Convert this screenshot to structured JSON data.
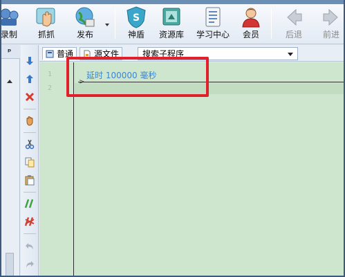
{
  "toolbar": {
    "items": [
      {
        "label": "录制",
        "icon": "record-icon"
      },
      {
        "label": "抓抓",
        "icon": "grab-hand-icon"
      },
      {
        "label": "发布",
        "icon": "publish-globe-icon"
      },
      {
        "label": "神盾",
        "icon": "shield-icon"
      },
      {
        "label": "资源库",
        "icon": "resource-library-icon"
      },
      {
        "label": "学习中心",
        "icon": "learning-center-icon"
      },
      {
        "label": "会员",
        "icon": "member-icon"
      },
      {
        "label": "后退",
        "icon": "back-arrow-icon"
      },
      {
        "label": "前进",
        "icon": "forward-arrow-icon"
      }
    ]
  },
  "leftpanel": {
    "pin": "ᵖ"
  },
  "tabs": {
    "normal": "普通",
    "source": "源文件",
    "subroutine_select": "搜索子程序"
  },
  "editor": {
    "line_numbers": [
      "1",
      "2"
    ],
    "lines": [
      "延时 100000 毫秒",
      ""
    ]
  },
  "colors": {
    "editor_bg": "#cde6cd",
    "code_text": "#3a86d6",
    "highlight": "#e0202a"
  }
}
